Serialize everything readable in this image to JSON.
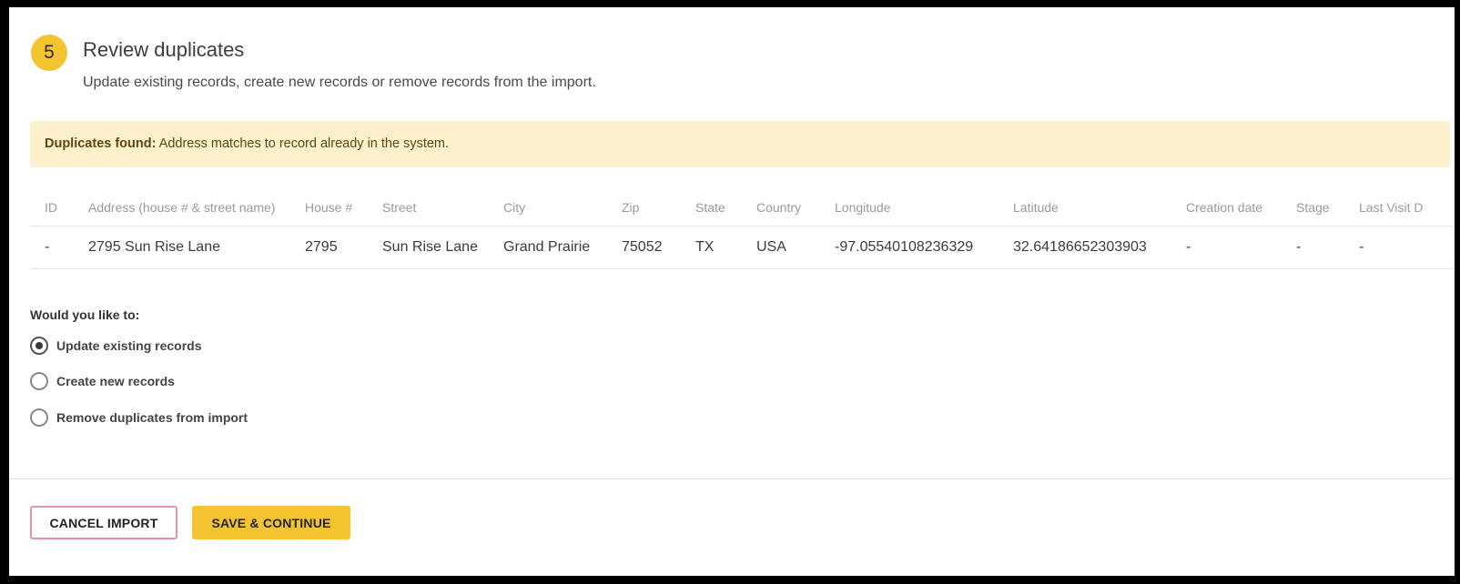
{
  "step": {
    "number": "5",
    "title": "Review duplicates",
    "subtitle": "Update existing records, create new records or remove records from the import."
  },
  "alert": {
    "bold": "Duplicates found:",
    "text": " Address matches to record already in the system."
  },
  "table": {
    "headers": [
      "ID",
      "Address (house # & street name)",
      "House #",
      "Street",
      "City",
      "Zip",
      "State",
      "Country",
      "Longitude",
      "Latitude",
      "Creation date",
      "Stage",
      "Last Visit D"
    ],
    "rows": [
      [
        "-",
        "2795 Sun Rise Lane",
        "2795",
        "Sun Rise Lane",
        "Grand Prairie",
        "75052",
        "TX",
        "USA",
        "-97.05540108236329",
        "32.64186652303903",
        "-",
        "-",
        "-"
      ]
    ]
  },
  "question": "Would you like to:",
  "options": [
    {
      "label": "Update existing records",
      "selected": true
    },
    {
      "label": "Create new records",
      "selected": false
    },
    {
      "label": "Remove duplicates from import",
      "selected": false
    }
  ],
  "buttons": {
    "cancel": "CANCEL IMPORT",
    "save": "SAVE & CONTINUE"
  },
  "colors": {
    "accent": "#f4c430",
    "alert_bg": "#fdf0cd",
    "cancel_border": "#e890a8"
  }
}
